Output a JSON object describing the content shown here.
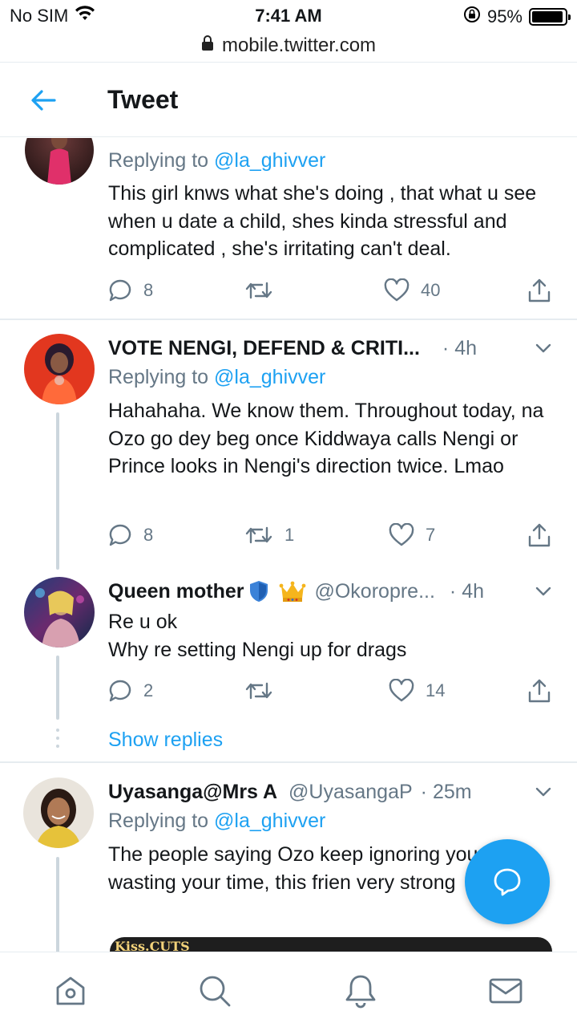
{
  "status_bar": {
    "carrier": "No SIM",
    "time": "7:41 AM",
    "battery": "95%",
    "battery_level": 0.95
  },
  "url_bar": {
    "url": "mobile.twitter.com"
  },
  "header": {
    "title": "Tweet"
  },
  "tweets": [
    {
      "replying_prefix": "Replying to",
      "replying_to": "@la_ghivver",
      "text": "This girl knws what she's doing , that what u see when u date a child, shes kinda stressful and complicated , she's irritating can't deal.",
      "replies": "8",
      "retweets": "",
      "likes": "40"
    },
    {
      "name": "VOTE NENGI, DEFEND & CRITI...",
      "time": "· 4h",
      "replying_prefix": "Replying to",
      "replying_to": "@la_ghivver",
      "text": "Hahahaha. We know them. Throughout today, na Ozo go dey beg once Kiddwaya calls Nengi or Prince looks in Nengi's direction twice. Lmao",
      "replies": "8",
      "retweets": "1",
      "likes": "7"
    },
    {
      "name": "Queen mother",
      "handle": "@Okoropre...",
      "time": "· 4h",
      "text_line1": "Re u ok",
      "text_line2": "Why re setting Nengi up for drags",
      "replies": "2",
      "retweets": "",
      "likes": "14"
    },
    {
      "name": "Uyasanga@Mrs A",
      "handle": "@UyasangaP",
      "time": "· 25m",
      "replying_prefix": "Replying to",
      "replying_to": "@la_ghivver",
      "text": "The people saying Ozo keep ignoring you are wasting your time, this frien very strong"
    }
  ],
  "show_replies": "Show replies",
  "media_caption": "Kiss.CUTS",
  "colors": {
    "accent": "#1da1f2",
    "secondary_text": "#657786",
    "divider": "#e6ecf0"
  },
  "icons": [
    "arrow-left-icon",
    "reply-icon",
    "retweet-icon",
    "heart-icon",
    "share-icon",
    "chevron-down-icon",
    "compose-reply-icon",
    "home-icon",
    "search-icon",
    "bell-icon",
    "mail-icon",
    "verified-shield-icon",
    "crown-icon",
    "lock-icon",
    "wifi-icon",
    "rotation-lock-icon"
  ]
}
